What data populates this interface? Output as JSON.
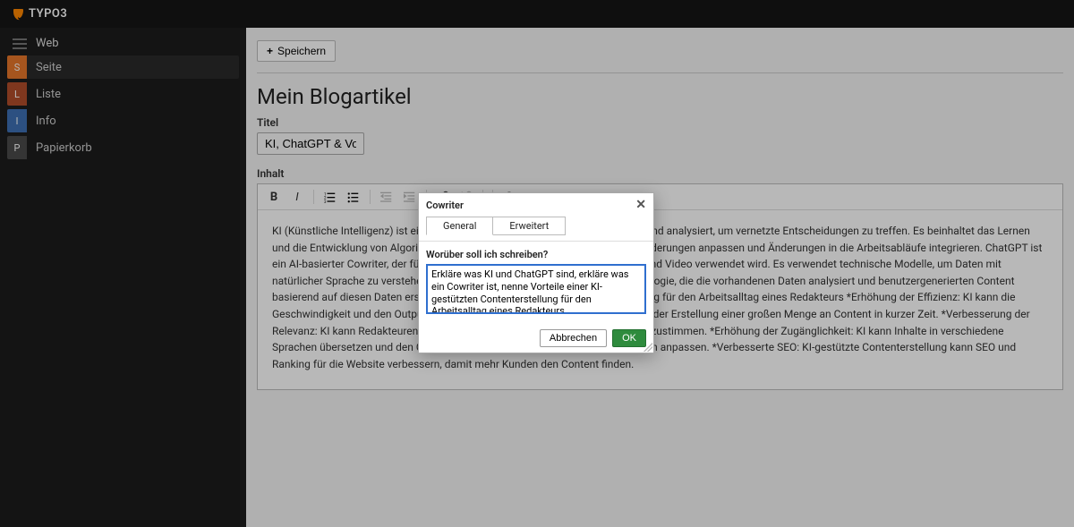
{
  "brand": {
    "name": "TYPO3"
  },
  "nav": {
    "section_label": "Web",
    "items": [
      {
        "key": "S",
        "label": "Seite"
      },
      {
        "key": "L",
        "label": "Liste"
      },
      {
        "key": "I",
        "label": "Info"
      },
      {
        "key": "P",
        "label": "Papierkorb"
      }
    ]
  },
  "actions": {
    "save": "Speichern"
  },
  "page": {
    "heading": "Mein Blogartikel",
    "title_label": "Titel",
    "title_value": "KI, ChatGPT & Vorteile e",
    "content_label": "Inhalt",
    "body_text": "KI (Künstliche Intelligenz) ist eine Technologie, die komplexe Daten verarbeitet und analysiert, um vernetzte Entscheidungen zu treffen. Es beinhaltet das Lernen und die Entwicklung von Algorithmen, die das Verhalten entsprechend der Anforderungen anpassen und Änderungen in die Arbeitsabläufe integrieren. ChatGPT ist ein AI-basierter Cowriter, der für text-basierte Anwendungen wie Text, Sprache und Video verwendet wird. Es verwendet technische Modelle, um Daten mit natürlicher Sprache zu verstehen und zu antworten. Ein Cowriter ist eine Technologie, die die vorhandenen Daten analysiert und benutzergenerierten Content basierend auf diesen Daten erstellt. Vorteile einer KI-gestützten Contenterstellung für den Arbeitsalltag eines Redakteurs *Erhöhung der Effizienz: KI kann die Geschwindigkeit und den Output von Redakteuren verbessern, insbesondere bei der Erstellung einer großen Menge an Content in kurzer Zeit. *Verbesserung der Relevanz: KI kann Redakteuren helfen, den Content besser auf die Zielgruppe abzustimmen. *Erhöhung der Zugänglichkeit: KI kann Inhalte in verschiedene Sprachen übersetzen und den Content für Benutzer mit besonderen Bedürfnissen anpassen. *Verbesserte SEO: KI-gestützte Contenterstellung kann SEO und Ranking für die Website verbessern, damit mehr Kunden den Content finden."
  },
  "toolbar_icons": {
    "bold": "B",
    "italic": "I",
    "ol": "ol",
    "ul": "ul",
    "outdent": "⇤",
    "indent": "⇥",
    "link": "🔗",
    "unlink": "⊘",
    "help": "?"
  },
  "dialog": {
    "title": "Cowriter",
    "tabs": {
      "general": "General",
      "advanced": "Erweitert"
    },
    "prompt_label": "Worüber soll ich schreiben?",
    "prompt_value": "Erkläre was KI und ChatGPT sind, erkläre was ein Cowriter ist, nenne Vorteile einer KI-gestützten Contenterstellung für den Arbeitsalltag eines Redakteurs",
    "cancel": "Abbrechen",
    "ok": "OK"
  }
}
